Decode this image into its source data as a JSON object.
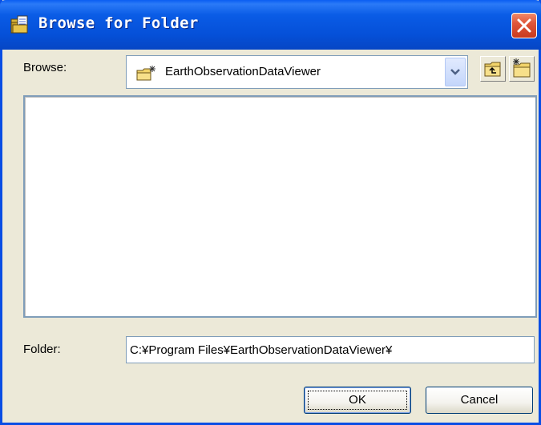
{
  "window": {
    "title": "Browse for Folder"
  },
  "browse": {
    "label": "Browse:",
    "selected": "EarthObservationDataViewer"
  },
  "folder": {
    "label": "Folder:",
    "value": "C:¥Program Files¥EarthObservationDataViewer¥"
  },
  "buttons": {
    "ok": "OK",
    "cancel": "Cancel"
  },
  "icons": {
    "title": "folder-icon",
    "combo": "folder-icon",
    "up": "up-folder-icon",
    "new_folder": "new-folder-icon",
    "dropdown": "chevron-down-icon",
    "close": "close-icon"
  },
  "colors": {
    "titlebar": "#0550d8",
    "dialog_bg": "#ece9d8",
    "close_button": "#e0563a",
    "input_border": "#7f9db9"
  }
}
